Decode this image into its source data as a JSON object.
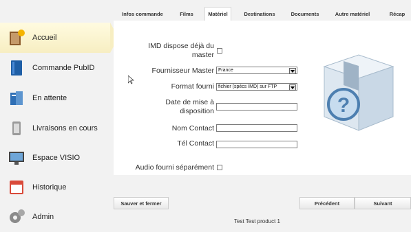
{
  "sidebar": {
    "items": [
      {
        "label": "Accueil",
        "icon": "home-icon"
      },
      {
        "label": "Commande PubID",
        "icon": "book-icon"
      },
      {
        "label": "En attente",
        "icon": "waiting-icon"
      },
      {
        "label": "Livraisons en cours",
        "icon": "delivery-icon"
      },
      {
        "label": "Espace VISIO",
        "icon": "monitor-icon"
      },
      {
        "label": "Historique",
        "icon": "calendar-icon"
      },
      {
        "label": "Admin",
        "icon": "gears-icon"
      }
    ]
  },
  "tabs": [
    "Infos commande",
    "Films",
    "Matériel",
    "Destinations",
    "Documents",
    "Autre matériel",
    "Récap"
  ],
  "form": {
    "imd_label": "IMD dispose déjà du master",
    "fournisseur_label": "Fournisseur Master",
    "fournisseur_value": "France",
    "format_label": "Format fourni",
    "format_value": "fichier (spécs IMD) sur FTP",
    "date_label": "Date de mise à disposition",
    "nom_label": "Nom Contact",
    "tel_label": "Tél Contact",
    "audio_label": "Audio fourni séparément"
  },
  "buttons": {
    "save": "Sauver et fermer",
    "previous": "Précédent",
    "next": "Suivant"
  },
  "footer": {
    "title": "Test Test product 1"
  },
  "image": {
    "icon": "question-box-icon"
  },
  "colors": {
    "active_nav": "#f7eec2",
    "background": "#f2f2f2",
    "box": "#d5e3ee"
  }
}
